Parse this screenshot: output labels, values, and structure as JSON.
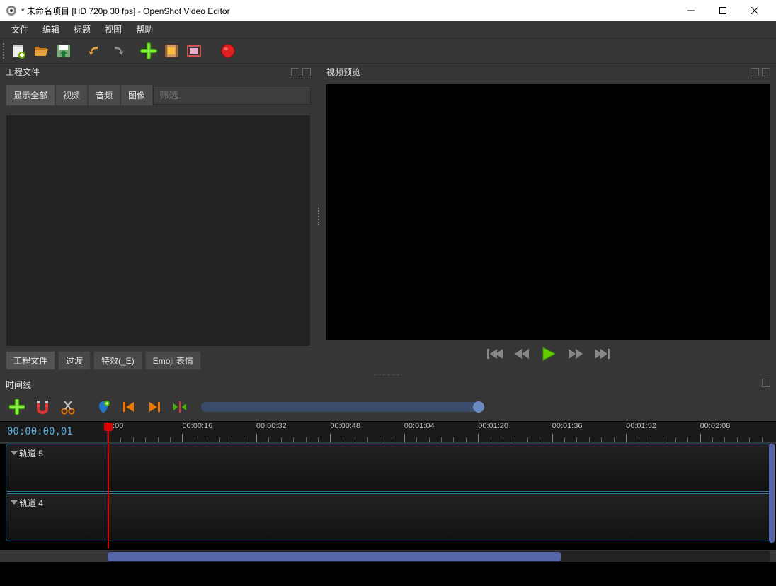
{
  "window": {
    "title": "* 未命名项目 [HD 720p 30 fps] - OpenShot Video Editor"
  },
  "menu": {
    "items": [
      {
        "label": "文件"
      },
      {
        "label": "编辑"
      },
      {
        "label": "标题"
      },
      {
        "label": "视图"
      },
      {
        "label": "帮助"
      }
    ]
  },
  "panels": {
    "project_files": {
      "title": "工程文件"
    },
    "preview": {
      "title": "视频预览"
    },
    "timeline": {
      "title": "时间线"
    }
  },
  "filter": {
    "tabs": {
      "all": "显示全部",
      "video": "视频",
      "audio": "音频",
      "image": "图像"
    },
    "placeholder": "筛选"
  },
  "bottom_tabs": {
    "tabs": [
      {
        "label": "工程文件",
        "active": true
      },
      {
        "label": "过渡"
      },
      {
        "label": "特效(_E)"
      },
      {
        "label": "Emoji 表情"
      }
    ]
  },
  "timeline": {
    "timecode": "00:00:00,01",
    "ticks": [
      "0:00",
      "00:00:16",
      "00:00:32",
      "00:00:48",
      "00:01:04",
      "00:01:20",
      "00:01:36",
      "00:01:52",
      "00:02:08"
    ],
    "tracks": [
      {
        "name": "轨道 5"
      },
      {
        "name": "轨道 4"
      }
    ]
  }
}
